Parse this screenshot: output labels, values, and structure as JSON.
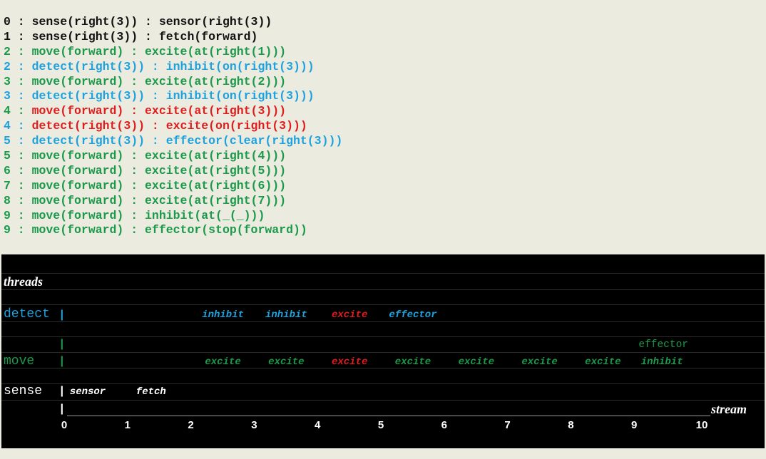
{
  "colors": {
    "black": "#111111",
    "green": "#1a9a4a",
    "blue": "#1ea2df",
    "red": "#e01d1d",
    "white": "#ffffff"
  },
  "trace_lines": [
    {
      "text": "0 : sense(right(3)) : sensor(right(3))",
      "color": "black"
    },
    {
      "text": "1 : sense(right(3)) : fetch(forward)",
      "color": "black"
    },
    {
      "text": "2 : move(forward) : excite(at(right(1)))",
      "color": "green"
    },
    {
      "text": "2 : detect(right(3)) : inhibit(on(right(3)))",
      "color": "blue"
    },
    {
      "text": "3 : move(forward) : excite(at(right(2)))",
      "color": "green"
    },
    {
      "text": "3 : detect(right(3)) : inhibit(on(right(3)))",
      "color": "blue"
    },
    {
      "text": "4 : move(forward) : excite(at(right(3)))",
      "color": "red",
      "prefix": "4 : ",
      "prefix_color": "green"
    },
    {
      "text": "4 : detect(right(3)) : excite(on(right(3)))",
      "color": "red",
      "prefix": "4 : ",
      "prefix_color": "blue"
    },
    {
      "text": "5 : detect(right(3)) : effector(clear(right(3)))",
      "color": "blue"
    },
    {
      "text": "5 : move(forward) : excite(at(right(4)))",
      "color": "green"
    },
    {
      "text": "6 : move(forward) : excite(at(right(5)))",
      "color": "green"
    },
    {
      "text": "7 : move(forward) : excite(at(right(6)))",
      "color": "green"
    },
    {
      "text": "8 : move(forward) : excite(at(right(7)))",
      "color": "green"
    },
    {
      "text": "9 : move(forward) : inhibit(at(_(_)))",
      "color": "green"
    },
    {
      "text": "9 : move(forward) : effector(stop(forward))",
      "color": "green"
    }
  ],
  "diagram": {
    "threads_label": "threads",
    "stream_label": "stream",
    "thread_names": {
      "detect": "detect",
      "move": "move",
      "sense": "sense"
    },
    "bar_glyph": "|",
    "ticks": [
      "0",
      "1",
      "2",
      "3",
      "4",
      "5",
      "6",
      "7",
      "8",
      "9",
      "10"
    ],
    "events": [
      {
        "thread": "detect",
        "t": 2,
        "label": "inhibit",
        "color": "blue"
      },
      {
        "thread": "detect",
        "t": 3,
        "label": "inhibit",
        "color": "blue"
      },
      {
        "thread": "detect",
        "t": 4,
        "label": "excite",
        "color": "red"
      },
      {
        "thread": "detect",
        "t": 5,
        "label": "effector",
        "color": "blue"
      },
      {
        "thread": "move",
        "t": 2,
        "label": "excite",
        "color": "green"
      },
      {
        "thread": "move",
        "t": 3,
        "label": "excite",
        "color": "green"
      },
      {
        "thread": "move",
        "t": 4,
        "label": "excite",
        "color": "red"
      },
      {
        "thread": "move",
        "t": 5,
        "label": "excite",
        "color": "green"
      },
      {
        "thread": "move",
        "t": 6,
        "label": "excite",
        "color": "green"
      },
      {
        "thread": "move",
        "t": 7,
        "label": "excite",
        "color": "green"
      },
      {
        "thread": "move",
        "t": 8,
        "label": "excite",
        "color": "green"
      },
      {
        "thread": "move",
        "t": 9,
        "label": "inhibit",
        "color": "green"
      },
      {
        "thread": "move-upper",
        "t": 9,
        "label": "effector",
        "color": "green"
      },
      {
        "thread": "sense",
        "t": 0,
        "label": "sensor",
        "color": "white"
      },
      {
        "thread": "sense",
        "t": 1,
        "label": "fetch",
        "color": "white"
      }
    ]
  }
}
